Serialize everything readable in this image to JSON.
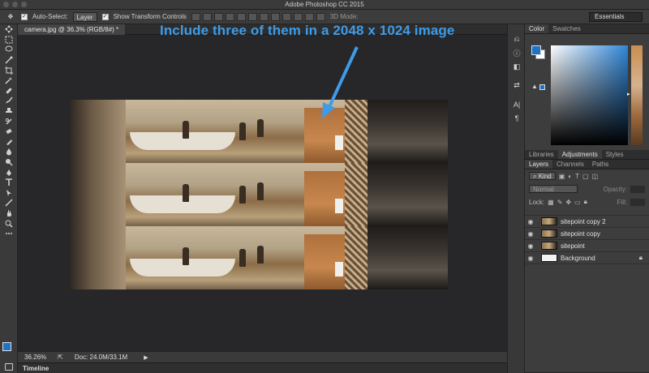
{
  "app": {
    "title": "Adobe Photoshop CC 2015"
  },
  "options": {
    "auto_select_label": "Auto-Select:",
    "auto_select_value": "Layer",
    "show_transform_label": "Show Transform Controls",
    "mode_3d_label": "3D Mode:",
    "workspace": "Essentials"
  },
  "document": {
    "tab_label": "camera.jpg @ 36.3% (RGB/8#) *"
  },
  "annotation": {
    "text": "Include three of them in a 2048 x 1024 image",
    "color": "#3f9be6"
  },
  "status": {
    "zoom": "36.26%",
    "doc": "Doc: 24.0M/33.1M"
  },
  "timeline": {
    "label": "Timeline"
  },
  "panels": {
    "color_tabs": [
      "Color",
      "Swatches"
    ],
    "adjust_tabs": [
      "Libraries",
      "Adjustments",
      "Styles"
    ],
    "layer_tabs": [
      "Layers",
      "Channels",
      "Paths"
    ],
    "kind_label": "Kind",
    "blend_mode": "Normal",
    "opacity_label": "Opacity:",
    "lock_label": "Lock:",
    "fill_label": "Fill:"
  },
  "layers": [
    {
      "name": "sitepoint copy 2",
      "locked": false
    },
    {
      "name": "sitepoint copy",
      "locked": false
    },
    {
      "name": "sitepoint",
      "locked": false
    },
    {
      "name": "Background",
      "locked": true
    }
  ],
  "colors": {
    "foreground": "#1f73c7",
    "background": "#ffffff",
    "accent": "#3f9be6"
  }
}
